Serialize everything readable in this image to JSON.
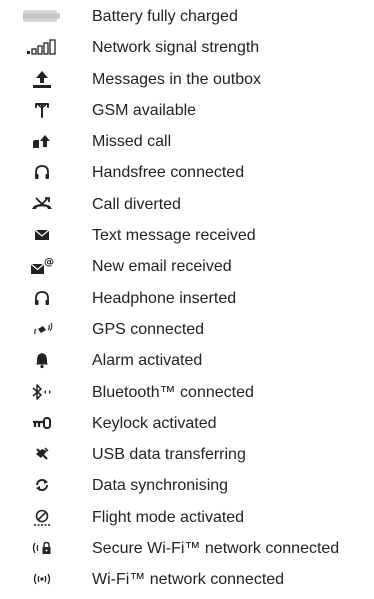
{
  "legend": {
    "items": [
      {
        "icon": "battery-full-icon",
        "label": "Battery fully charged"
      },
      {
        "icon": "signal-strength-icon",
        "label": "Network signal strength"
      },
      {
        "icon": "outbox-icon",
        "label": "Messages in the outbox"
      },
      {
        "icon": "gsm-icon",
        "label": "GSM available"
      },
      {
        "icon": "missed-call-icon",
        "label": "Missed call"
      },
      {
        "icon": "handsfree-icon",
        "label": "Handsfree connected"
      },
      {
        "icon": "call-divert-icon",
        "label": "Call diverted"
      },
      {
        "icon": "envelope-icon",
        "label": "Text message received"
      },
      {
        "icon": "email-icon",
        "label": "New email received"
      },
      {
        "icon": "headphone-icon",
        "label": "Headphone inserted"
      },
      {
        "icon": "gps-icon",
        "label": "GPS connected"
      },
      {
        "icon": "alarm-bell-icon",
        "label": "Alarm activated"
      },
      {
        "icon": "bluetooth-icon",
        "label": "Bluetooth™ connected"
      },
      {
        "icon": "keylock-icon",
        "label": "Keylock activated"
      },
      {
        "icon": "usb-transfer-icon",
        "label": "USB data transferring"
      },
      {
        "icon": "sync-icon",
        "label": "Data synchronising"
      },
      {
        "icon": "flight-mode-icon",
        "label": "Flight mode activated"
      },
      {
        "icon": "secure-wifi-icon",
        "label": "Secure Wi-Fi™ network connected"
      },
      {
        "icon": "wifi-icon",
        "label": "Wi-Fi™ network connected"
      }
    ]
  }
}
